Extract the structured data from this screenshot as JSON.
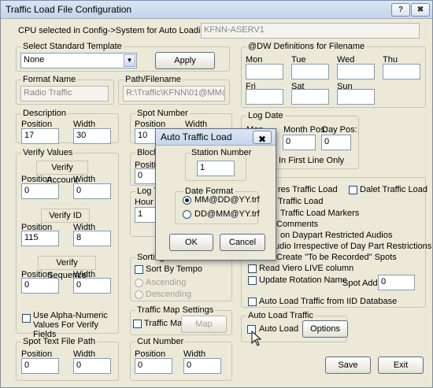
{
  "window": {
    "title": "Traffic Load File Configuration",
    "help_glyph": "?",
    "close_glyph": "✖"
  },
  "cpu": {
    "label": "CPU selected in Config->System for Auto Loading Traffic is:",
    "value": "KFNN-ASERV1"
  },
  "template": {
    "title": "Select Standard Template",
    "value": "None",
    "apply": "Apply"
  },
  "format": {
    "title": "Format Name",
    "value": "Radio Traffic"
  },
  "path": {
    "title": "Path/Filename",
    "value": "R:\\Traffic\\KFNN\\01@MM@DD@"
  },
  "description": {
    "title": "Description",
    "position_label": "Position",
    "width_label": "Width",
    "position": "17",
    "width": "30"
  },
  "spot": {
    "title": "Spot Number",
    "position_label": "Position",
    "width_label": "Width",
    "position": "10"
  },
  "verify": {
    "title": "Verify Values",
    "account": {
      "title": "Verify Account",
      "position_label": "Position",
      "width_label": "Width",
      "position": "0",
      "width": "0"
    },
    "id": {
      "title": "Verify ID",
      "position_label": "Position",
      "width_label": "Width",
      "position": "115",
      "width": "8"
    },
    "sequence": {
      "title": "Verify Sequence",
      "position_label": "Position",
      "width_label": "Width",
      "position": "0",
      "width": "0"
    },
    "alnum_label": "Use Alpha-Numeric Values For Verify Fields"
  },
  "block": {
    "title": "Block L",
    "pos_label": "Position",
    "position": "0"
  },
  "logtime": {
    "title": "Log Tim",
    "hour_label": "Hour Po",
    "position": "1"
  },
  "sorting": {
    "title": "Sorting",
    "tempo": "Sort By Tempo",
    "ascending": "Ascending",
    "descending": "Descending"
  },
  "trafficmap": {
    "title": "Traffic Map Settings",
    "check_label": "Traffic Map",
    "button": "Map"
  },
  "spottext": {
    "title": "Spot Text File Path",
    "position_label": "Position",
    "width_label": "Width",
    "position": "0",
    "width": "0"
  },
  "cutnumber": {
    "title": "Cut Number",
    "position_label": "Position",
    "width_label": "Width",
    "position": "0",
    "width": "0"
  },
  "dw": {
    "title": "@DW Definitions for Filename",
    "days": [
      "Mon",
      "Tue",
      "Wed",
      "Thu",
      "Fri",
      "Sat",
      "Sun"
    ]
  },
  "logdate": {
    "title": "Log Date",
    "prefix": "Mon",
    "month_label": "Month Pos:",
    "month": "0",
    "day_label": "Day Pos:",
    "day": "0",
    "first_line": "In First Line Only"
  },
  "options": {
    "title": "ions",
    "items": [
      "res Traffic Load",
      "Traffic Load",
      "Traffic Load Markers",
      "Comments",
      "on Daypart Restricted Audios",
      "udio Irrespective of Day Part Restrictions",
      "Create \"To be Recorded\" Spots",
      "Read Viero LIVE column",
      "Update Rotation Name",
      "Auto Load Traffic from IID Database"
    ],
    "dalet": "Dalet Traffic Load",
    "spot_add_label": "Spot Add",
    "spot_add": "0"
  },
  "autoload": {
    "title": "Auto Load Traffic",
    "check_label": "Auto Load",
    "options_button": "Options"
  },
  "footer": {
    "save": "Save",
    "exit": "Exit"
  },
  "modal": {
    "title": "Auto Traffic Load",
    "close_glyph": "✖",
    "station_label": "Station Number",
    "station": "1",
    "date_format_title": "Date Format",
    "formats": [
      "MM@DD@YY.trf",
      "DD@MM@YY.trf"
    ],
    "ok": "OK",
    "cancel": "Cancel"
  },
  "icons": {
    "dropdown": "chevron-down-icon",
    "close": "close-icon",
    "help": "help-icon",
    "cursor": "mouse-pointer-icon"
  }
}
